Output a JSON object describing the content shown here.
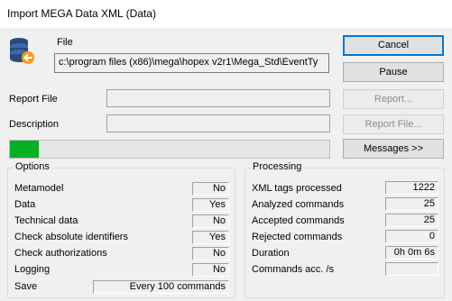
{
  "window": {
    "title": "Import MEGA Data XML (Data)"
  },
  "icon": "database-import-icon",
  "file": {
    "label": "File",
    "value": "c:\\program files (x86)\\mega\\hopex v2r1\\Mega_Std\\EventTy"
  },
  "report_file": {
    "label": "Report File",
    "value": ""
  },
  "description": {
    "label": "Description",
    "value": ""
  },
  "buttons": {
    "cancel": "Cancel",
    "pause": "Pause",
    "report": "Report...",
    "report_file": "Report File...",
    "messages": "Messages >>"
  },
  "progress": {
    "fraction": 0.09
  },
  "options": {
    "title": "Options",
    "rows": [
      {
        "label": "Metamodel",
        "value": "No"
      },
      {
        "label": "Data",
        "value": "Yes"
      },
      {
        "label": "Technical data",
        "value": "No"
      },
      {
        "label": "Check absolute identifiers",
        "value": "Yes"
      },
      {
        "label": "Check authorizations",
        "value": "No"
      },
      {
        "label": "Logging",
        "value": "No"
      }
    ],
    "save": {
      "label": "Save",
      "value": "Every 100 commands"
    }
  },
  "processing": {
    "title": "Processing",
    "rows": [
      {
        "label": "XML tags processed",
        "value": "1222"
      },
      {
        "label": "Analyzed commands",
        "value": "25"
      },
      {
        "label": "Accepted commands",
        "value": "25"
      },
      {
        "label": "Rejected commands",
        "value": "0"
      },
      {
        "label": "Duration",
        "value": "0h 0m 6s"
      },
      {
        "label": "Commands acc. /s",
        "value": ""
      }
    ]
  },
  "colors": {
    "progress": "#06b025",
    "default_button_border": "#0078d7",
    "icon_db": "#2b4a7a",
    "icon_arrow": "#f39c12"
  }
}
